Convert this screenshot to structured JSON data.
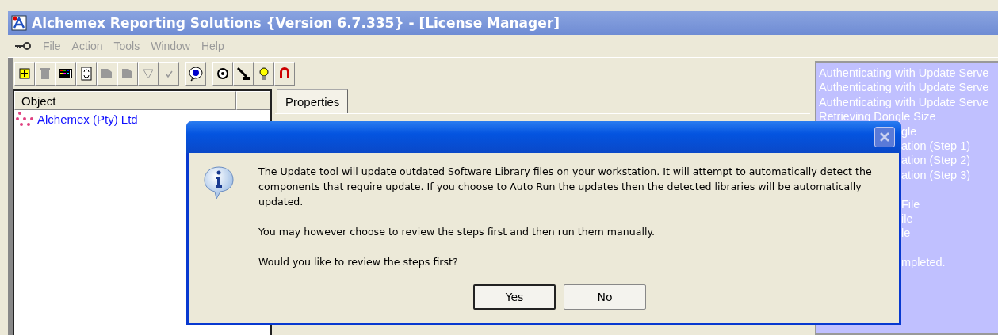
{
  "window": {
    "title": "Alchemex Reporting Solutions {Version 6.7.335} - [License Manager]"
  },
  "menu": [
    {
      "label": "File",
      "disabled": true
    },
    {
      "label": "Action",
      "disabled": true
    },
    {
      "label": "Tools",
      "disabled": true
    },
    {
      "label": "Window",
      "disabled": true
    },
    {
      "label": "Help",
      "disabled": true
    }
  ],
  "object_panel": {
    "columns": [
      "Object"
    ],
    "items": [
      {
        "label": "Alchemex (Pty) Ltd"
      }
    ]
  },
  "tabs": [
    {
      "label": "Properties",
      "selected": true
    }
  ],
  "log": [
    {
      "text": "Authenticating with Update Serve",
      "kind": "full"
    },
    {
      "text": "Authenticating with Update Serve",
      "kind": "full"
    },
    {
      "text": "Authenticating with Update Serve",
      "kind": "full"
    },
    {
      "text": "Retrieving Dongle Size",
      "kind": "full"
    },
    {
      "text": "gle",
      "kind": "cut"
    },
    {
      "text": "ation (Step 1)",
      "kind": "cut"
    },
    {
      "text": "ation (Step 2)",
      "kind": "cut"
    },
    {
      "text": "ation (Step 3)",
      "kind": "cut"
    },
    {
      "kind": "blank"
    },
    {
      "text": "File",
      "kind": "cut"
    },
    {
      "text": "ile",
      "kind": "cut"
    },
    {
      "text": "le",
      "kind": "cut"
    },
    {
      "kind": "blank"
    },
    {
      "text": "mpleted.",
      "kind": "cut"
    }
  ],
  "dialog": {
    "paragraphs": [
      "The Update tool will update outdated Software Library files on your workstation. It will attempt to automatically detect the components that require update. If you choose to Auto Run the updates then the detected libraries will be automatically updated.",
      "You may however choose to review the steps first and then run them manually.",
      "Would you like to review the steps first?"
    ],
    "buttons": [
      {
        "label": "Yes",
        "selected": true
      },
      {
        "label": "No",
        "selected": false
      }
    ]
  }
}
